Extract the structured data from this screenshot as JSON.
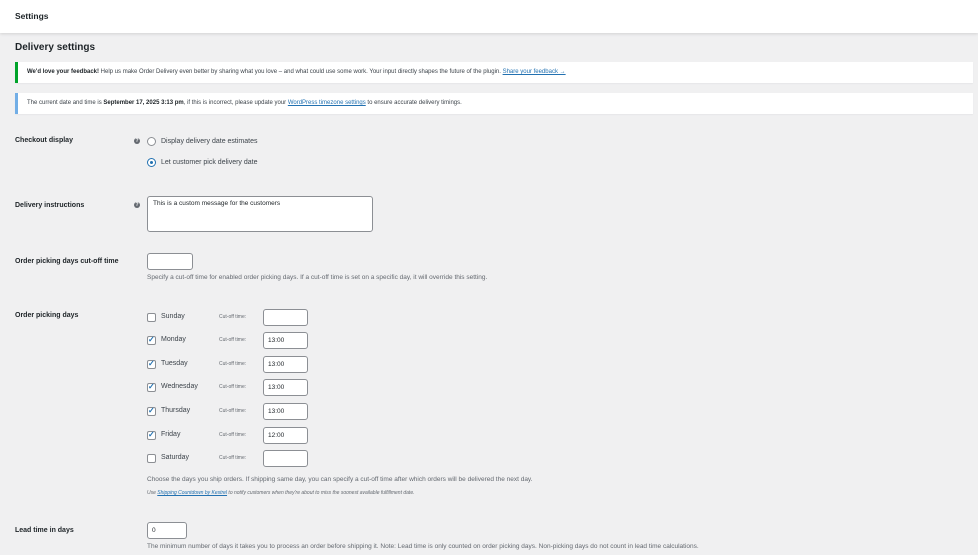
{
  "header": {
    "title": "Settings"
  },
  "section": {
    "title": "Delivery settings"
  },
  "feedback_notice": {
    "bold": "We'd love your feedback!",
    "text": " Help us make Order Delivery even better by sharing what you love – and what could use some work. Your input directly shapes the future of the plugin. ",
    "link": "Share your feedback →"
  },
  "date_notice": {
    "prefix": "The current date and time is ",
    "datetime": "September 17, 2025 3:13 pm",
    "middle": ", if this is incorrect, please update your ",
    "link": "WordPress timezone settings",
    "suffix": " to ensure accurate delivery timings."
  },
  "checkout_display": {
    "label": "Checkout display",
    "options": [
      "Display delivery date estimates",
      "Let customer pick delivery date"
    ],
    "selected": 1
  },
  "delivery_instructions": {
    "label": "Delivery instructions",
    "value": "This is a custom message for the customers"
  },
  "cutoff": {
    "label": "Order picking days cut-off time",
    "value": "",
    "description": "Specify a cut-off time for enabled order picking days. If a cut-off time is set on a specific day, it will override this setting."
  },
  "picking_days": {
    "label": "Order picking days",
    "cutoff_label": "Cut-off time:",
    "days": [
      {
        "name": "Sunday",
        "checked": false,
        "time": ""
      },
      {
        "name": "Monday",
        "checked": true,
        "time": "13:00"
      },
      {
        "name": "Tuesday",
        "checked": true,
        "time": "13:00"
      },
      {
        "name": "Wednesday",
        "checked": true,
        "time": "13:00"
      },
      {
        "name": "Thursday",
        "checked": true,
        "time": "13:00"
      },
      {
        "name": "Friday",
        "checked": true,
        "time": "12:00"
      },
      {
        "name": "Saturday",
        "checked": false,
        "time": ""
      }
    ],
    "description": "Choose the days you ship orders. If shipping same day, you can specify a cut-off time after which orders will be delivered the next day.",
    "note_prefix": "Use ",
    "note_link": "Shipping Countdown by Kestrel",
    "note_suffix": " to notify customers when they're about to miss the soonest available fulfillment date."
  },
  "lead_time": {
    "label": "Lead time in days",
    "value": "0",
    "description": "The minimum number of days it takes you to process an order before shipping it. Note: Lead time is only counted on order picking days. Non-picking days do not count in lead time calculations."
  }
}
